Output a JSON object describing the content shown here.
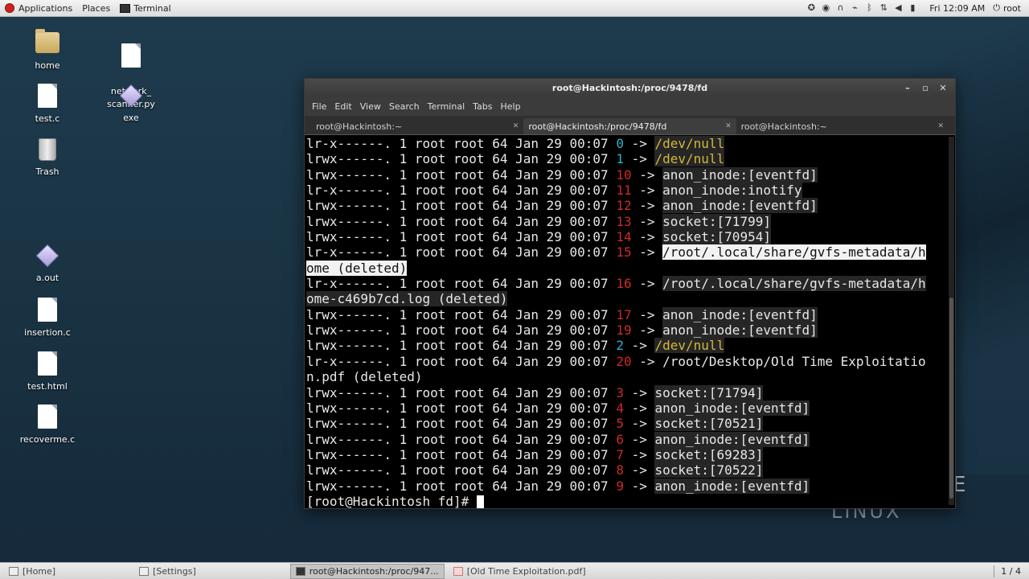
{
  "top_panel": {
    "applications": "Applications",
    "places": "Places",
    "terminal": "Terminal",
    "clock": "Fri 12:09 AM",
    "user": "root",
    "tray_icons": [
      "accessibility-icon",
      "speaker-icon",
      "headphones-icon",
      "usb-icon",
      "bluetooth-icon",
      "network-icon",
      "volume-icon",
      "battery-icon"
    ]
  },
  "desktop": {
    "icons": [
      {
        "label": "home",
        "type": "folder"
      },
      {
        "label": "network_\nscanner.py",
        "type": "file"
      },
      {
        "label": "test.c",
        "type": "file"
      },
      {
        "label": "exe",
        "type": "exec"
      },
      {
        "label": "Trash",
        "type": "trash"
      },
      {
        "label": "a.out",
        "type": "exec"
      },
      {
        "label": "insertion.c",
        "type": "file"
      },
      {
        "label": "test.html",
        "type": "file"
      },
      {
        "label": "recoverme.c",
        "type": "file"
      }
    ],
    "wallpaper_e": "E",
    "wallpaper_linux": "LINUX"
  },
  "terminal": {
    "title": "root@Hackintosh:/proc/9478/fd",
    "menu": [
      "File",
      "Edit",
      "View",
      "Search",
      "Terminal",
      "Tabs",
      "Help"
    ],
    "tabs": [
      {
        "label": "root@Hackintosh:~",
        "active": false
      },
      {
        "label": "root@Hackintosh:/proc/9478/fd",
        "active": true
      },
      {
        "label": "root@Hackintosh:~",
        "active": false
      }
    ],
    "lines": [
      {
        "perm": "lr-x------.",
        "fd": "0",
        "arrow": "->",
        "target": "/dev/null",
        "color": "yellow",
        "fdcolor": "cyan"
      },
      {
        "perm": "lrwx------.",
        "fd": "1",
        "arrow": "->",
        "target": "/dev/null",
        "color": "yellow",
        "fdcolor": "cyan"
      },
      {
        "perm": "lrwx------.",
        "fd": "10",
        "arrow": "->",
        "target": "anon_inode:[eventfd]"
      },
      {
        "perm": "lr-x------.",
        "fd": "11",
        "arrow": "->",
        "target": "anon_inode:inotify"
      },
      {
        "perm": "lrwx------.",
        "fd": "12",
        "arrow": "->",
        "target": "anon_inode:[eventfd]"
      },
      {
        "perm": "lrwx------.",
        "fd": "13",
        "arrow": "->",
        "target": "socket:[71799]"
      },
      {
        "perm": "lrwx------.",
        "fd": "14",
        "arrow": "->",
        "target": "socket:[70954]"
      },
      {
        "perm": "lr-x------.",
        "fd": "15",
        "arrow": "->",
        "target": "/root/.local/share/gvfs-metadata/h",
        "cont": "ome (deleted)",
        "style": "sel"
      },
      {
        "perm": "lr-x------.",
        "fd": "16",
        "arrow": "->",
        "target": "/root/.local/share/gvfs-metadata/h",
        "cont": "ome-c469b7cd.log (deleted)"
      },
      {
        "perm": "lrwx------.",
        "fd": "17",
        "arrow": "->",
        "target": "anon_inode:[eventfd]"
      },
      {
        "perm": "lrwx------.",
        "fd": "19",
        "arrow": "->",
        "target": "anon_inode:[eventfd]"
      },
      {
        "perm": "lrwx------.",
        "fd": "2",
        "arrow": "->",
        "target": "/dev/null",
        "color": "yellow",
        "fdcolor": "cyan"
      },
      {
        "perm": "lr-x------.",
        "fd": "20",
        "arrow": "->",
        "target": "/root/Desktop/Old Time Exploitatio",
        "cont": "n.pdf (deleted)",
        "style": "dark"
      },
      {
        "perm": "lrwx------.",
        "fd": "3",
        "arrow": "->",
        "target": "socket:[71794]"
      },
      {
        "perm": "lrwx------.",
        "fd": "4",
        "arrow": "->",
        "target": "anon_inode:[eventfd]"
      },
      {
        "perm": "lrwx------.",
        "fd": "5",
        "arrow": "->",
        "target": "socket:[70521]"
      },
      {
        "perm": "lrwx------.",
        "fd": "6",
        "arrow": "->",
        "target": "anon_inode:[eventfd]"
      },
      {
        "perm": "lrwx------.",
        "fd": "7",
        "arrow": "->",
        "target": "socket:[69283]"
      },
      {
        "perm": "lrwx------.",
        "fd": "8",
        "arrow": "->",
        "target": "socket:[70522]"
      },
      {
        "perm": "lrwx------.",
        "fd": "9",
        "arrow": "->",
        "target": "anon_inode:[eventfd]"
      }
    ],
    "common": {
      "links": "1",
      "owner": "root",
      "group": "root",
      "size": "64",
      "date": "Jan 29 00:07"
    },
    "prompt": "[root@Hackintosh fd]# "
  },
  "bottom_panel": {
    "tasks": [
      {
        "label": "[Home]",
        "icon": "folder",
        "active": false
      },
      {
        "label": "[Settings]",
        "icon": "settings",
        "active": false
      },
      {
        "label": "root@Hackintosh:/proc/947...",
        "icon": "term",
        "active": true
      },
      {
        "label": "[Old Time Exploitation.pdf]",
        "icon": "pdf",
        "active": false
      }
    ],
    "workspace": "1 / 4"
  }
}
